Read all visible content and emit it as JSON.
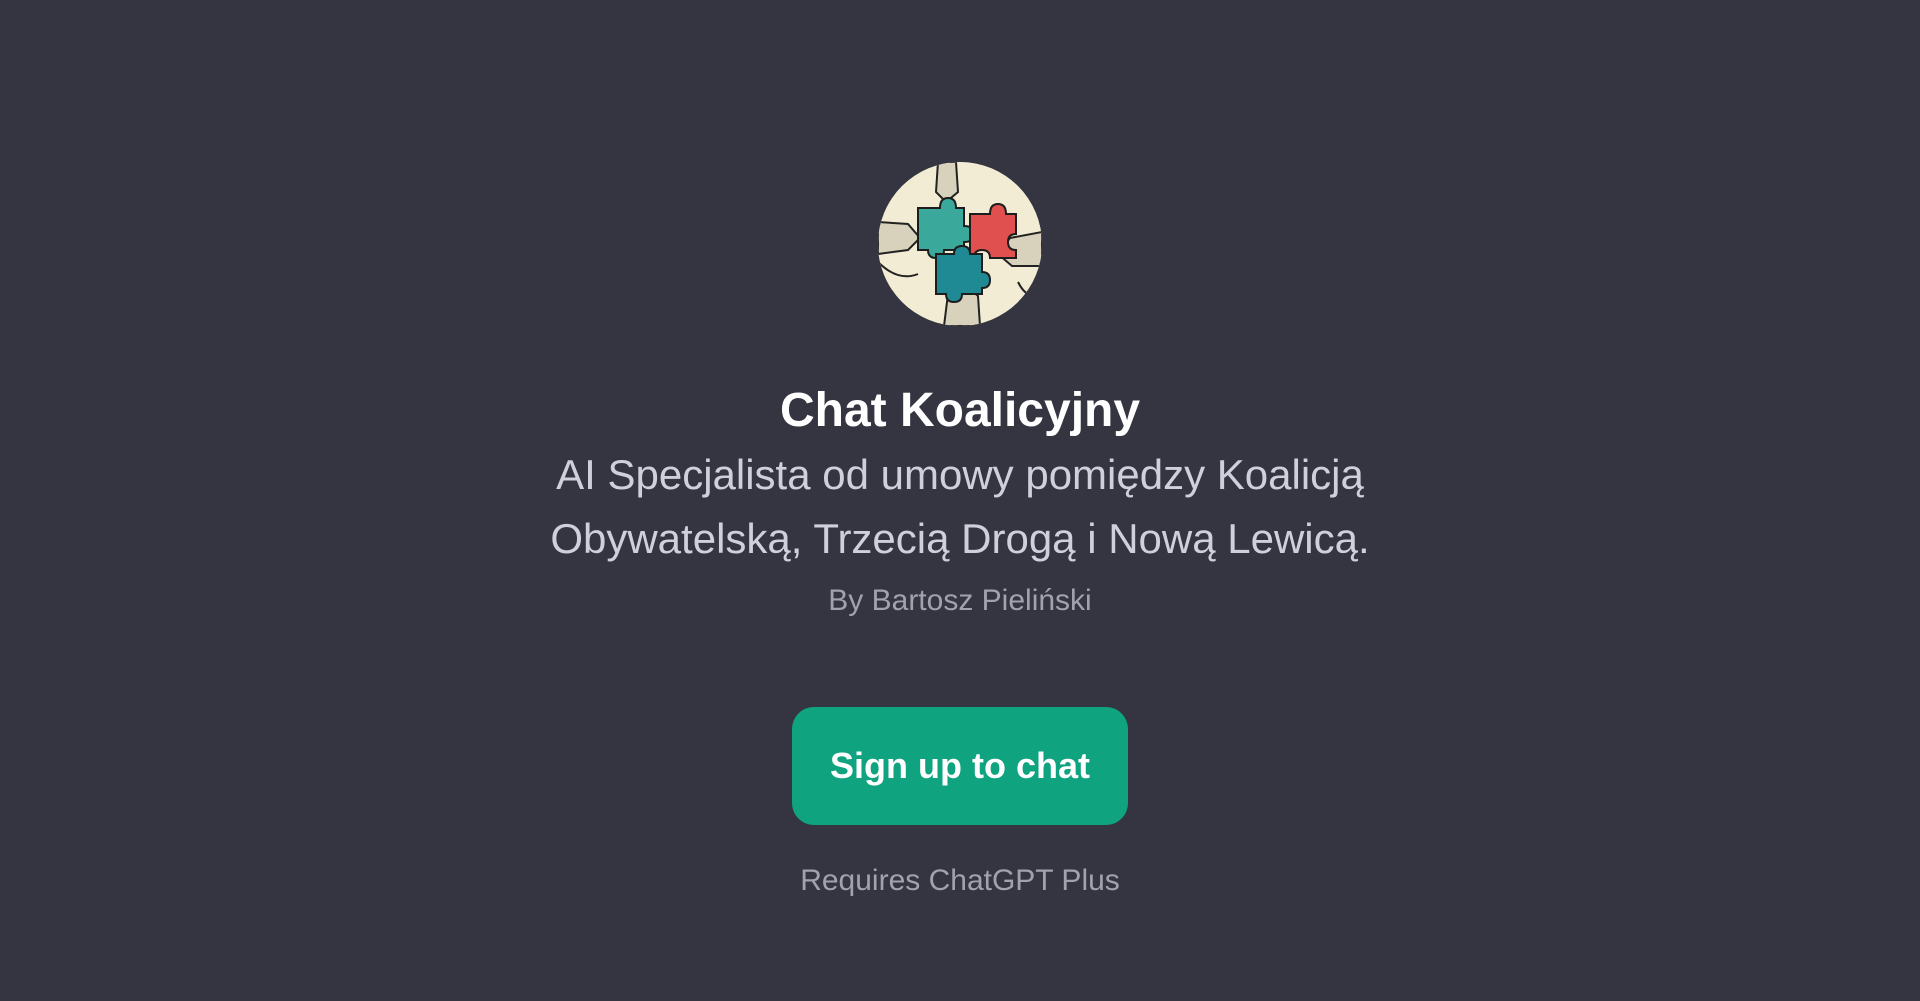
{
  "gpt": {
    "name": "Chat Koalicyjny",
    "description": "AI Specjalista od umowy pomiędzy Koalicją Obywatelską, Trzecią Drogą i Nową Lewicą.",
    "author": "By Bartosz Pieliński",
    "avatar_icon": "puzzle-hands-icon"
  },
  "actions": {
    "signup_label": "Sign up to chat",
    "requirement_note": "Requires ChatGPT Plus"
  },
  "colors": {
    "background": "#343541",
    "accent": "#10a37f",
    "title": "#ffffff",
    "description": "#d0d0dc",
    "muted": "#a2a2ae"
  }
}
